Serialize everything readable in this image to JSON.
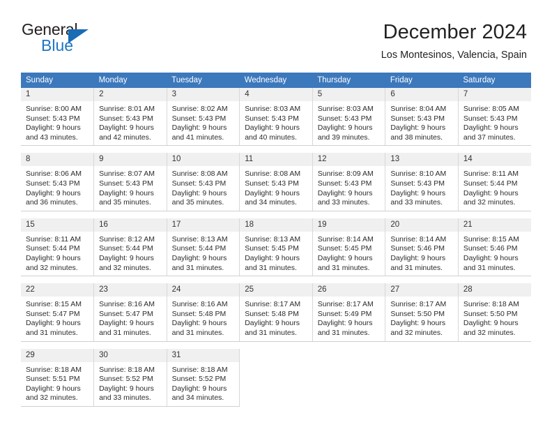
{
  "logo": {
    "word1": "General",
    "word2": "Blue",
    "accent_color": "#1a6cb5",
    "text_color": "#231f20"
  },
  "header": {
    "title": "December 2024",
    "subtitle": "Los Montesinos, Valencia, Spain",
    "header_bg": "#3c78bc",
    "daynum_bg": "#f0f0f0"
  },
  "weekdays": [
    "Sunday",
    "Monday",
    "Tuesday",
    "Wednesday",
    "Thursday",
    "Friday",
    "Saturday"
  ],
  "weeks": [
    [
      {
        "day": "1",
        "sunrise": "Sunrise: 8:00 AM",
        "sunset": "Sunset: 5:43 PM",
        "daylight1": "Daylight: 9 hours",
        "daylight2": "and 43 minutes."
      },
      {
        "day": "2",
        "sunrise": "Sunrise: 8:01 AM",
        "sunset": "Sunset: 5:43 PM",
        "daylight1": "Daylight: 9 hours",
        "daylight2": "and 42 minutes."
      },
      {
        "day": "3",
        "sunrise": "Sunrise: 8:02 AM",
        "sunset": "Sunset: 5:43 PM",
        "daylight1": "Daylight: 9 hours",
        "daylight2": "and 41 minutes."
      },
      {
        "day": "4",
        "sunrise": "Sunrise: 8:03 AM",
        "sunset": "Sunset: 5:43 PM",
        "daylight1": "Daylight: 9 hours",
        "daylight2": "and 40 minutes."
      },
      {
        "day": "5",
        "sunrise": "Sunrise: 8:03 AM",
        "sunset": "Sunset: 5:43 PM",
        "daylight1": "Daylight: 9 hours",
        "daylight2": "and 39 minutes."
      },
      {
        "day": "6",
        "sunrise": "Sunrise: 8:04 AM",
        "sunset": "Sunset: 5:43 PM",
        "daylight1": "Daylight: 9 hours",
        "daylight2": "and 38 minutes."
      },
      {
        "day": "7",
        "sunrise": "Sunrise: 8:05 AM",
        "sunset": "Sunset: 5:43 PM",
        "daylight1": "Daylight: 9 hours",
        "daylight2": "and 37 minutes."
      }
    ],
    [
      {
        "day": "8",
        "sunrise": "Sunrise: 8:06 AM",
        "sunset": "Sunset: 5:43 PM",
        "daylight1": "Daylight: 9 hours",
        "daylight2": "and 36 minutes."
      },
      {
        "day": "9",
        "sunrise": "Sunrise: 8:07 AM",
        "sunset": "Sunset: 5:43 PM",
        "daylight1": "Daylight: 9 hours",
        "daylight2": "and 35 minutes."
      },
      {
        "day": "10",
        "sunrise": "Sunrise: 8:08 AM",
        "sunset": "Sunset: 5:43 PM",
        "daylight1": "Daylight: 9 hours",
        "daylight2": "and 35 minutes."
      },
      {
        "day": "11",
        "sunrise": "Sunrise: 8:08 AM",
        "sunset": "Sunset: 5:43 PM",
        "daylight1": "Daylight: 9 hours",
        "daylight2": "and 34 minutes."
      },
      {
        "day": "12",
        "sunrise": "Sunrise: 8:09 AM",
        "sunset": "Sunset: 5:43 PM",
        "daylight1": "Daylight: 9 hours",
        "daylight2": "and 33 minutes."
      },
      {
        "day": "13",
        "sunrise": "Sunrise: 8:10 AM",
        "sunset": "Sunset: 5:43 PM",
        "daylight1": "Daylight: 9 hours",
        "daylight2": "and 33 minutes."
      },
      {
        "day": "14",
        "sunrise": "Sunrise: 8:11 AM",
        "sunset": "Sunset: 5:44 PM",
        "daylight1": "Daylight: 9 hours",
        "daylight2": "and 32 minutes."
      }
    ],
    [
      {
        "day": "15",
        "sunrise": "Sunrise: 8:11 AM",
        "sunset": "Sunset: 5:44 PM",
        "daylight1": "Daylight: 9 hours",
        "daylight2": "and 32 minutes."
      },
      {
        "day": "16",
        "sunrise": "Sunrise: 8:12 AM",
        "sunset": "Sunset: 5:44 PM",
        "daylight1": "Daylight: 9 hours",
        "daylight2": "and 32 minutes."
      },
      {
        "day": "17",
        "sunrise": "Sunrise: 8:13 AM",
        "sunset": "Sunset: 5:44 PM",
        "daylight1": "Daylight: 9 hours",
        "daylight2": "and 31 minutes."
      },
      {
        "day": "18",
        "sunrise": "Sunrise: 8:13 AM",
        "sunset": "Sunset: 5:45 PM",
        "daylight1": "Daylight: 9 hours",
        "daylight2": "and 31 minutes."
      },
      {
        "day": "19",
        "sunrise": "Sunrise: 8:14 AM",
        "sunset": "Sunset: 5:45 PM",
        "daylight1": "Daylight: 9 hours",
        "daylight2": "and 31 minutes."
      },
      {
        "day": "20",
        "sunrise": "Sunrise: 8:14 AM",
        "sunset": "Sunset: 5:46 PM",
        "daylight1": "Daylight: 9 hours",
        "daylight2": "and 31 minutes."
      },
      {
        "day": "21",
        "sunrise": "Sunrise: 8:15 AM",
        "sunset": "Sunset: 5:46 PM",
        "daylight1": "Daylight: 9 hours",
        "daylight2": "and 31 minutes."
      }
    ],
    [
      {
        "day": "22",
        "sunrise": "Sunrise: 8:15 AM",
        "sunset": "Sunset: 5:47 PM",
        "daylight1": "Daylight: 9 hours",
        "daylight2": "and 31 minutes."
      },
      {
        "day": "23",
        "sunrise": "Sunrise: 8:16 AM",
        "sunset": "Sunset: 5:47 PM",
        "daylight1": "Daylight: 9 hours",
        "daylight2": "and 31 minutes."
      },
      {
        "day": "24",
        "sunrise": "Sunrise: 8:16 AM",
        "sunset": "Sunset: 5:48 PM",
        "daylight1": "Daylight: 9 hours",
        "daylight2": "and 31 minutes."
      },
      {
        "day": "25",
        "sunrise": "Sunrise: 8:17 AM",
        "sunset": "Sunset: 5:48 PM",
        "daylight1": "Daylight: 9 hours",
        "daylight2": "and 31 minutes."
      },
      {
        "day": "26",
        "sunrise": "Sunrise: 8:17 AM",
        "sunset": "Sunset: 5:49 PM",
        "daylight1": "Daylight: 9 hours",
        "daylight2": "and 31 minutes."
      },
      {
        "day": "27",
        "sunrise": "Sunrise: 8:17 AM",
        "sunset": "Sunset: 5:50 PM",
        "daylight1": "Daylight: 9 hours",
        "daylight2": "and 32 minutes."
      },
      {
        "day": "28",
        "sunrise": "Sunrise: 8:18 AM",
        "sunset": "Sunset: 5:50 PM",
        "daylight1": "Daylight: 9 hours",
        "daylight2": "and 32 minutes."
      }
    ],
    [
      {
        "day": "29",
        "sunrise": "Sunrise: 8:18 AM",
        "sunset": "Sunset: 5:51 PM",
        "daylight1": "Daylight: 9 hours",
        "daylight2": "and 32 minutes."
      },
      {
        "day": "30",
        "sunrise": "Sunrise: 8:18 AM",
        "sunset": "Sunset: 5:52 PM",
        "daylight1": "Daylight: 9 hours",
        "daylight2": "and 33 minutes."
      },
      {
        "day": "31",
        "sunrise": "Sunrise: 8:18 AM",
        "sunset": "Sunset: 5:52 PM",
        "daylight1": "Daylight: 9 hours",
        "daylight2": "and 34 minutes."
      },
      null,
      null,
      null,
      null
    ]
  ]
}
